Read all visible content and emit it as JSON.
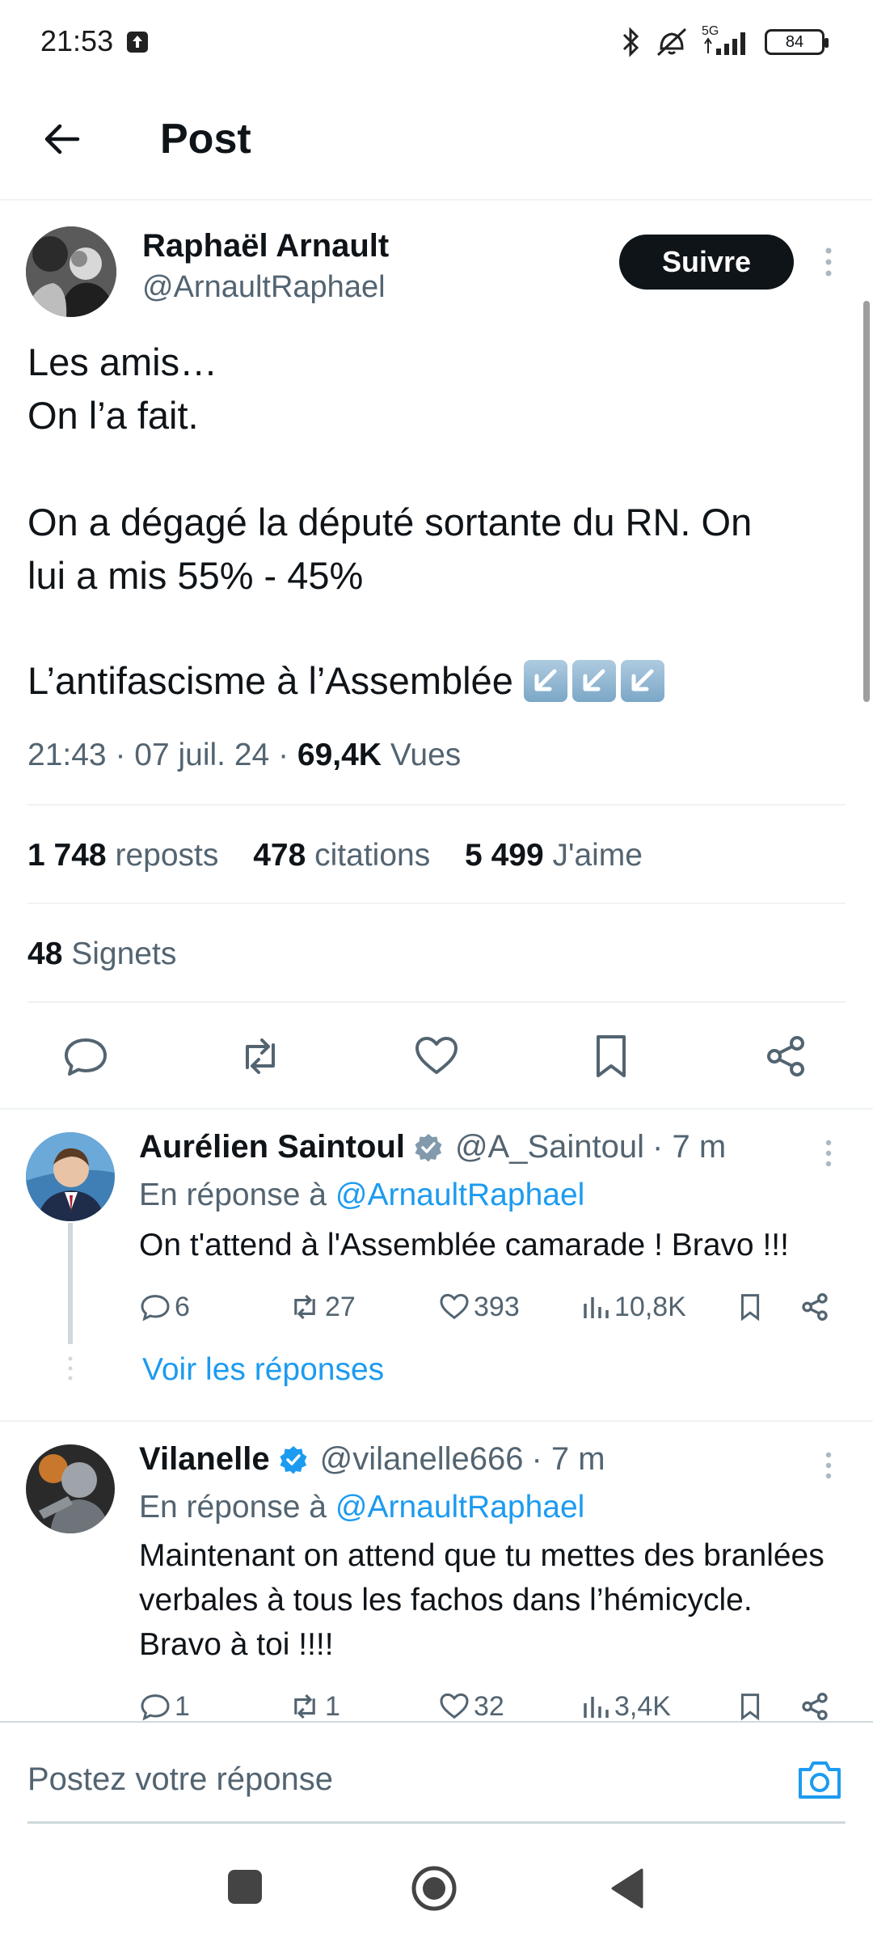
{
  "status_bar": {
    "time": "21:53",
    "network": "5G",
    "battery": "84",
    "icons": [
      "upload-icon",
      "bluetooth-icon",
      "vibrate-off-icon",
      "signal-icon",
      "battery-icon"
    ]
  },
  "header": {
    "title": "Post"
  },
  "post": {
    "author_name": "Raphaël Arnault",
    "author_handle": "@ArnaultRaphael",
    "follow_label": "Suivre",
    "lines": [
      "Les amis…",
      "On l’a fait.",
      "On a dégagé la député sortante du RN. On",
      "lui a mis 55% - 45%",
      "L’antifascisme à l’Assemblée"
    ],
    "time": "21:43",
    "date": "07 juil. 24",
    "views_count": "69,4K",
    "views_label": "Vues",
    "reposts_count": "1 748",
    "reposts_label": "reposts",
    "quotes_count": "478",
    "quotes_label": "citations",
    "likes_count": "5 499",
    "likes_label": "J'aime",
    "bookmarks_count": "48",
    "bookmarks_label": "Signets"
  },
  "replies": [
    {
      "name": "Aurélien Saintoul",
      "handle": "@A_Saintoul",
      "age": "· 7 m",
      "reply_to_label": "En réponse à",
      "reply_to_handle": "@ArnaultRaphael",
      "text": "On t'attend à l'Assemblée camarade ! Bravo !!!",
      "comments": "6",
      "reposts": "27",
      "likes": "393",
      "views": "10,8K",
      "show_replies_label": "Voir les réponses"
    },
    {
      "name": "Vilanelle",
      "handle": "@vilanelle666",
      "age": "· 7 m",
      "reply_to_label": "En réponse à",
      "reply_to_handle": "@ArnaultRaphael",
      "text": "Maintenant on attend que tu mettes des branlées verbales à tous les fachos dans l’hémicycle. Bravo à toi !!!!",
      "comments": "1",
      "reposts": "1",
      "likes": "32",
      "views": "3,4K"
    }
  ],
  "composer": {
    "placeholder": "Postez votre réponse"
  },
  "colors": {
    "accent": "#1d9bf0",
    "text": "#0f1419",
    "secondary": "#536471",
    "divider": "#eff3f4"
  }
}
